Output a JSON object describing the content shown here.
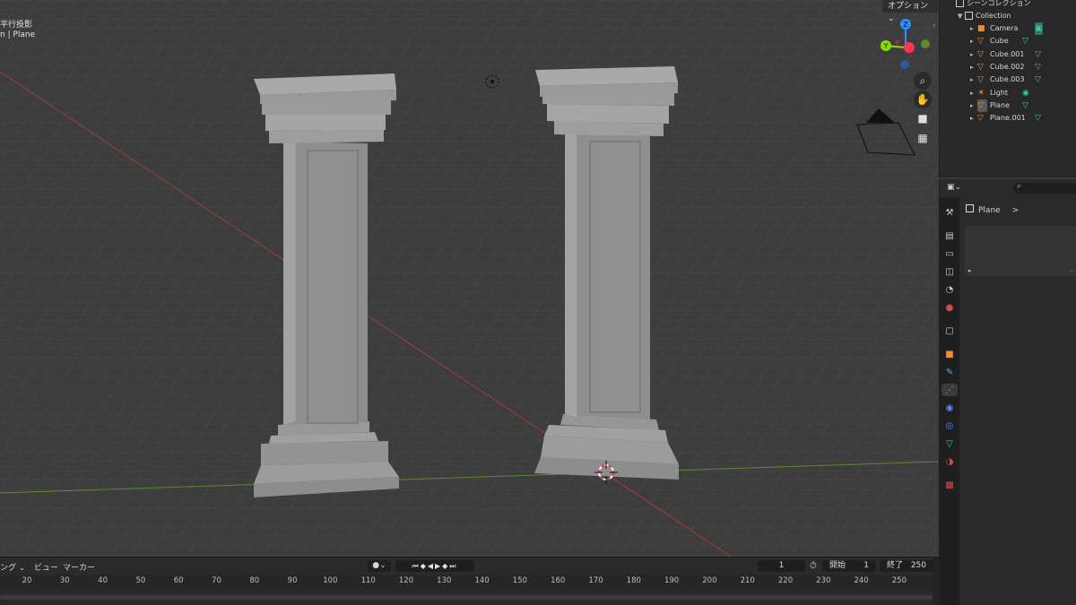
{
  "viewport": {
    "mode_text": "平行投影",
    "object_text": "n | Plane",
    "options_label": "オプション ⌄",
    "gizmo_labels": {
      "z": "Z",
      "y": "Y",
      "x": "X"
    }
  },
  "outliner": {
    "scene_collection": "シーンコレクション",
    "collection": "Collection",
    "items": [
      {
        "label": "Camera",
        "kind": "camera"
      },
      {
        "label": "Cube",
        "kind": "mesh"
      },
      {
        "label": "Cube.001",
        "kind": "mesh"
      },
      {
        "label": "Cube.002",
        "kind": "mesh"
      },
      {
        "label": "Cube.003",
        "kind": "mesh"
      },
      {
        "label": "Light",
        "kind": "light"
      },
      {
        "label": "Plane",
        "kind": "mesh",
        "active": true
      },
      {
        "label": "Plane.001",
        "kind": "mesh"
      }
    ]
  },
  "properties": {
    "breadcrumb": "Plane",
    "breadcrumb_arrow": ">"
  },
  "timeline": {
    "menu": [
      "ング ⌄",
      "ビュー",
      "マーカー"
    ],
    "current_frame": "1",
    "start_label": "開始",
    "start_value": "1",
    "end_label": "終了",
    "end_value": "250",
    "ticks": [
      "20",
      "30",
      "40",
      "50",
      "60",
      "70",
      "80",
      "90",
      "100",
      "110",
      "120",
      "130",
      "140",
      "150",
      "160",
      "170",
      "180",
      "190",
      "200",
      "210",
      "220",
      "230",
      "240",
      "250"
    ]
  },
  "colors": {
    "accent_selected": "#334d80",
    "axis_x": "#ff3352",
    "axis_y": "#8bdc00",
    "axis_z": "#2890ff",
    "mesh_icon": "#e88d3a",
    "data_icon": "#35c9a4"
  }
}
